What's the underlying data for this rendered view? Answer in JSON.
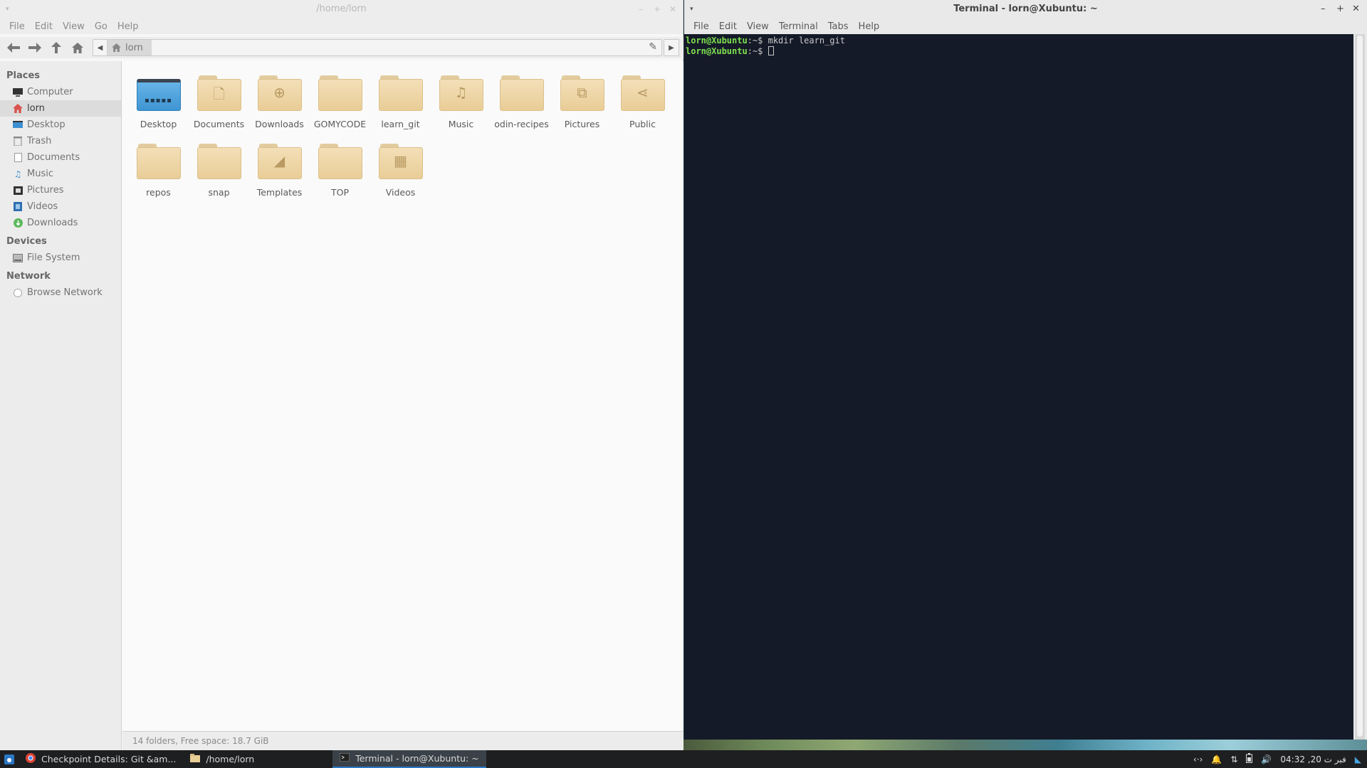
{
  "file_manager": {
    "title": "/home/lorn",
    "menu": [
      "File",
      "Edit",
      "View",
      "Go",
      "Help"
    ],
    "path_crumb": "lorn",
    "sidebar": {
      "places_heading": "Places",
      "places": [
        {
          "label": "Computer",
          "icon": "computer-icon"
        },
        {
          "label": "lorn",
          "icon": "home-icon",
          "active": true
        },
        {
          "label": "Desktop",
          "icon": "desktop-icon"
        },
        {
          "label": "Trash",
          "icon": "trash-icon"
        },
        {
          "label": "Documents",
          "icon": "documents-icon"
        },
        {
          "label": "Music",
          "icon": "music-icon"
        },
        {
          "label": "Pictures",
          "icon": "pictures-icon"
        },
        {
          "label": "Videos",
          "icon": "videos-icon"
        },
        {
          "label": "Downloads",
          "icon": "downloads-icon"
        }
      ],
      "devices_heading": "Devices",
      "devices": [
        {
          "label": "File System",
          "icon": "drive-icon"
        }
      ],
      "network_heading": "Network",
      "network": [
        {
          "label": "Browse Network",
          "icon": "network-icon"
        }
      ]
    },
    "folders": [
      {
        "label": "Desktop",
        "icon": "desktop-folder-icon"
      },
      {
        "label": "Documents",
        "icon": "documents-folder-icon"
      },
      {
        "label": "Downloads",
        "icon": "downloads-folder-icon"
      },
      {
        "label": "GOMYCODE",
        "icon": "folder-icon"
      },
      {
        "label": "learn_git",
        "icon": "folder-icon"
      },
      {
        "label": "Music",
        "icon": "music-folder-icon"
      },
      {
        "label": "odin-recipes",
        "icon": "folder-icon"
      },
      {
        "label": "Pictures",
        "icon": "pictures-folder-icon"
      },
      {
        "label": "Public",
        "icon": "public-folder-icon"
      },
      {
        "label": "repos",
        "icon": "folder-icon"
      },
      {
        "label": "snap",
        "icon": "folder-icon"
      },
      {
        "label": "Templates",
        "icon": "templates-folder-icon"
      },
      {
        "label": "TOP",
        "icon": "folder-icon"
      },
      {
        "label": "Videos",
        "icon": "videos-folder-icon"
      }
    ],
    "status": "14 folders, Free space: 18.7 GiB"
  },
  "terminal": {
    "title": "Terminal - lorn@Xubuntu: ~",
    "menu": [
      "File",
      "Edit",
      "View",
      "Terminal",
      "Tabs",
      "Help"
    ],
    "lines": [
      {
        "prompt": "lorn@Xubuntu",
        "path": ":~$ ",
        "command": "mkdir learn_git"
      },
      {
        "prompt": "lorn@Xubuntu",
        "path": ":~$ ",
        "command": ""
      }
    ]
  },
  "panel": {
    "tasks": [
      {
        "label": "Checkpoint Details: Git &am...",
        "icon": "chrome-icon",
        "active": false
      },
      {
        "label": "/home/lorn",
        "icon": "folder-icon",
        "active": false
      },
      {
        "label": "Terminal - lorn@Xubuntu: ~",
        "icon": "terminal-icon",
        "active": true
      }
    ],
    "clock": "04:32 ,20 فبر ت"
  },
  "colors": {
    "prompt_green": "#7ee04f",
    "terminal_bg": "#151a28",
    "folder_tan": "#ecd3a3",
    "panel_bg": "#1e1f21"
  }
}
